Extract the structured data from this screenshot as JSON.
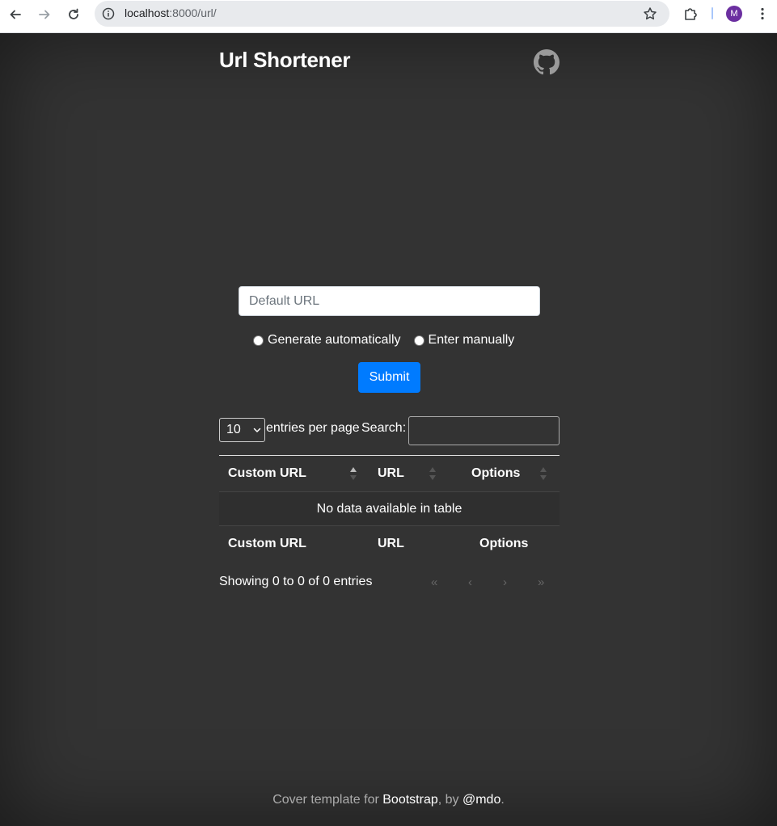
{
  "browser": {
    "url_host": "localhost",
    "url_path": ":8000/url/",
    "avatar_letter": "M"
  },
  "header": {
    "brand": "Url Shortener",
    "github_icon": "github-icon"
  },
  "form": {
    "url_placeholder": "Default URL",
    "radio_auto_label": "Generate automatically",
    "radio_manual_label": "Enter manually",
    "submit_label": "Submit"
  },
  "table_controls": {
    "page_length": "10",
    "entries_label": "entries per page",
    "search_label": "Search:"
  },
  "table": {
    "columns": [
      "Custom URL",
      "URL",
      "Options"
    ],
    "empty_message": "No data available in table"
  },
  "pagination": {
    "info": "Showing 0 to 0 of 0 entries",
    "first": "«",
    "prev": "‹",
    "next": "›",
    "last": "»"
  },
  "footer": {
    "prefix": "Cover template for ",
    "bootstrap_link": "Bootstrap",
    "middle": ", by ",
    "author_link": "@mdo",
    "suffix": "."
  },
  "colors": {
    "background": "#333333",
    "primary": "#007bff"
  }
}
